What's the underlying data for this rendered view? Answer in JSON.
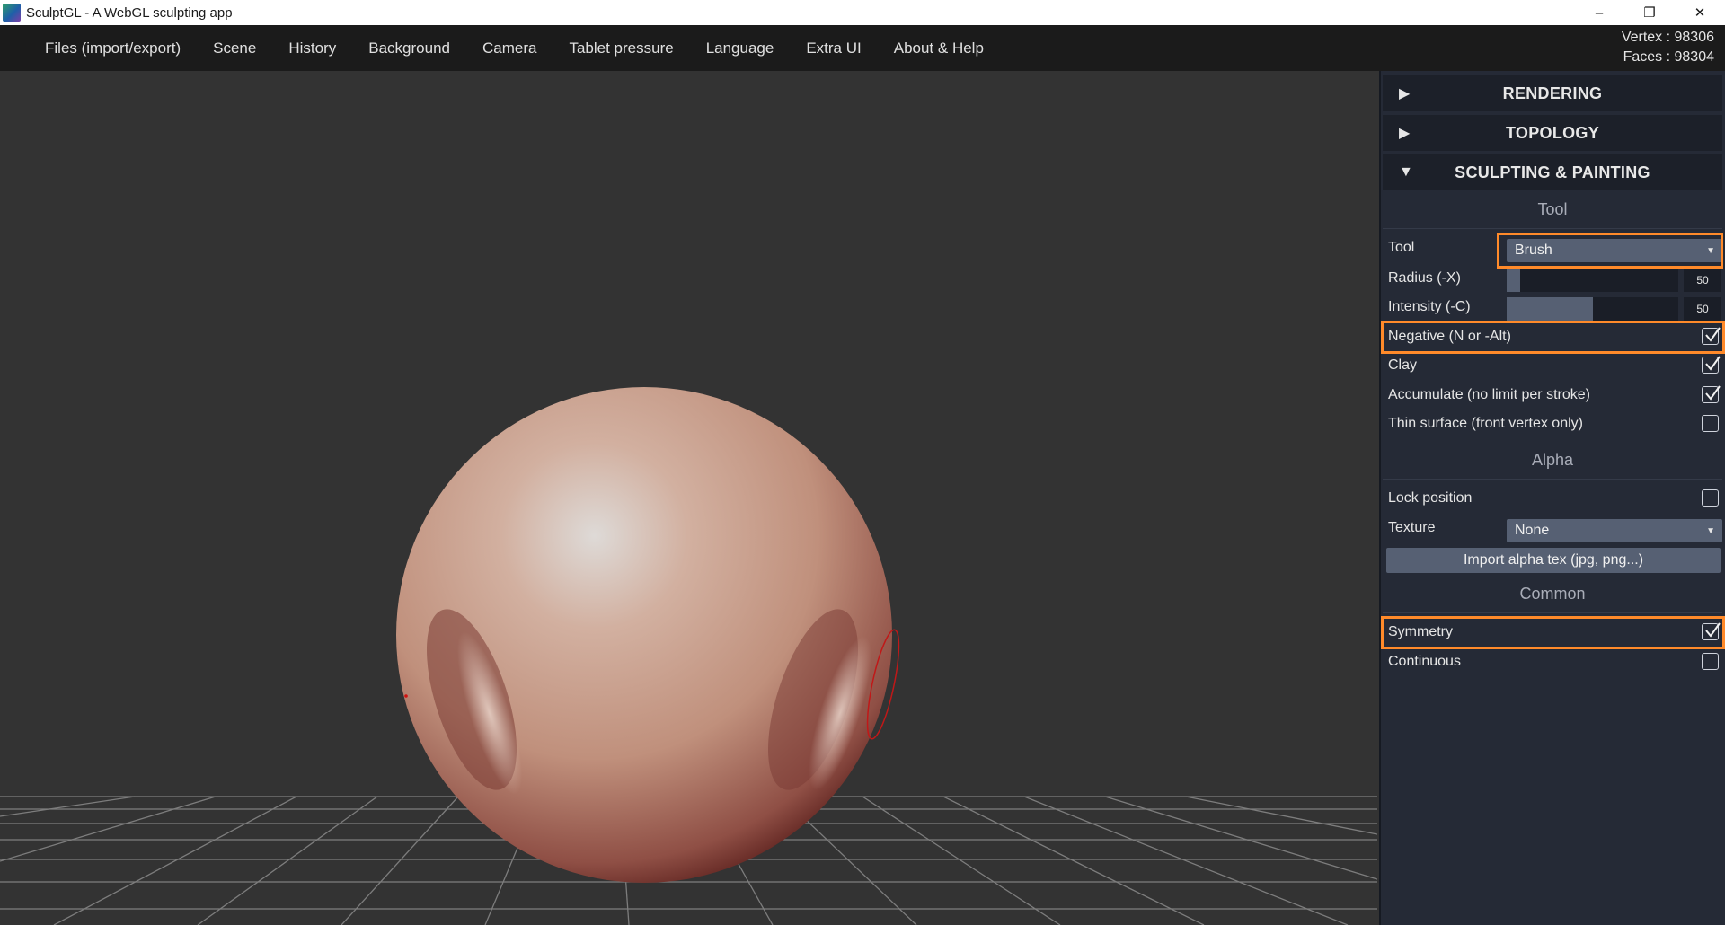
{
  "window": {
    "title": "SculptGL - A WebGL sculpting app",
    "minimize_glyph": "–",
    "restore_glyph": "❐",
    "close_glyph": "✕"
  },
  "menu": [
    "Files (import/export)",
    "Scene",
    "History",
    "Background",
    "Camera",
    "Tablet pressure",
    "Language",
    "Extra UI",
    "About & Help"
  ],
  "stats": {
    "vertex": "Vertex : 98306",
    "faces": "Faces : 98304"
  },
  "panel": {
    "folders": [
      {
        "title": "RENDERING",
        "arrow": "▶"
      },
      {
        "title": "TOPOLOGY",
        "arrow": "▶"
      },
      {
        "title": "SCULPTING & PAINTING",
        "arrow": "▼"
      }
    ],
    "tool_section": {
      "title": "Tool",
      "tool_label": "Tool",
      "tool_value": "Brush",
      "radius": {
        "label": "Radius (-X)",
        "value": "50",
        "fill_fraction": 0.08
      },
      "intensity": {
        "label": "Intensity (-C)",
        "value": "50",
        "fill_fraction": 0.5
      },
      "options": [
        {
          "label": "Negative (N or -Alt)",
          "checked": true
        },
        {
          "label": "Clay",
          "checked": true
        },
        {
          "label": "Accumulate (no limit per stroke)",
          "checked": true
        },
        {
          "label": "Thin surface (front vertex only)",
          "checked": false
        }
      ]
    },
    "alpha_section": {
      "title": "Alpha",
      "lock_label": "Lock position",
      "lock_checked": false,
      "texture_label": "Texture",
      "texture_value": "None",
      "import_label": "Import alpha tex (jpg, png...)"
    },
    "common_section": {
      "title": "Common",
      "symmetry_label": "Symmetry",
      "symmetry_checked": true,
      "continuous_label": "Continuous",
      "continuous_checked": false
    }
  },
  "colors": {
    "highlight": "#ff8a2a",
    "panel_bg": "#252a36",
    "viewport_bg": "#333333",
    "widget": "#566073"
  }
}
